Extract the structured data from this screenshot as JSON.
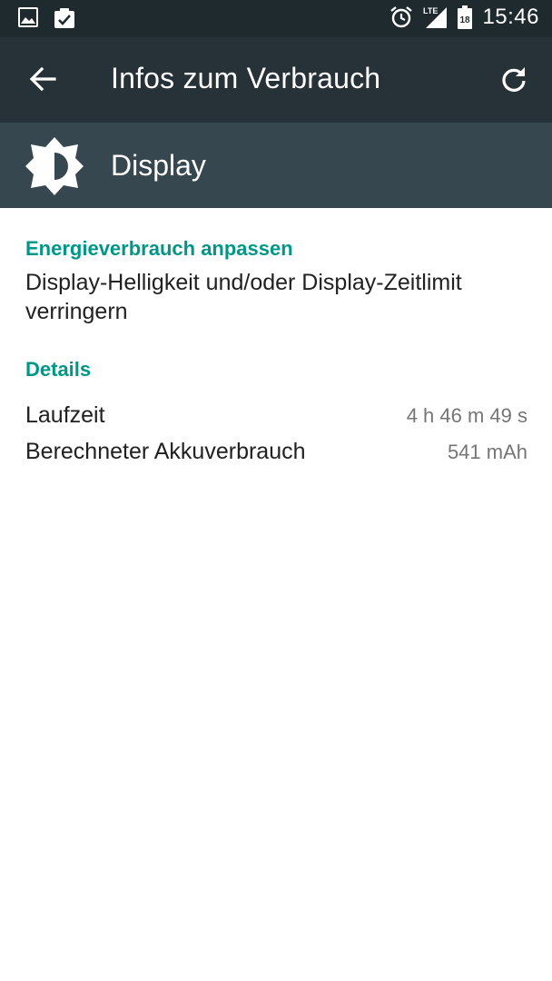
{
  "status_bar": {
    "time": "15:46",
    "network_label": "LTE",
    "battery_level": "18",
    "icons": [
      "gallery-icon",
      "clipboard-check-icon",
      "alarm-icon",
      "signal-icon",
      "battery-icon"
    ]
  },
  "app_bar": {
    "title": "Infos zum Verbrauch",
    "back_icon": "arrow-back-icon",
    "refresh_icon": "refresh-icon"
  },
  "item": {
    "title": "Display",
    "icon": "brightness-icon"
  },
  "tip_section": {
    "heading": "Energieverbrauch anpassen",
    "text": "Display-Helligkeit und/oder Display-Zeitlimit verringern"
  },
  "details_section": {
    "heading": "Details",
    "rows": [
      {
        "label": "Laufzeit",
        "value": "4 h 46 m 49 s"
      },
      {
        "label": "Berechneter Akkuverbrauch",
        "value": "541 mAh"
      }
    ]
  },
  "colors": {
    "status_bar": "#1f2a2f",
    "app_bar": "#263238",
    "item_header": "#37474f",
    "accent": "#009688",
    "primary_text": "#212121",
    "secondary_text": "#757575"
  }
}
